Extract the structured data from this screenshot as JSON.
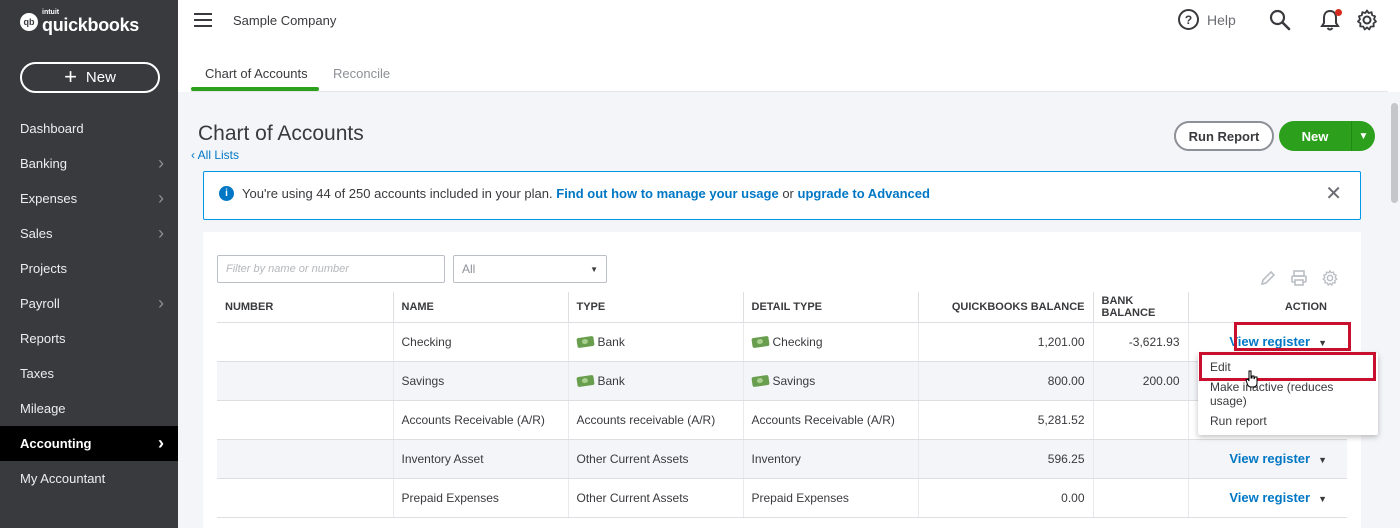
{
  "sidebar": {
    "logo_badge": "qb",
    "logo_intuit": "intuit",
    "logo_name": "quickbooks",
    "new_label": "New",
    "items": [
      {
        "label": "Dashboard",
        "chevron": false
      },
      {
        "label": "Banking",
        "chevron": true
      },
      {
        "label": "Expenses",
        "chevron": true
      },
      {
        "label": "Sales",
        "chevron": true
      },
      {
        "label": "Projects",
        "chevron": false
      },
      {
        "label": "Payroll",
        "chevron": true
      },
      {
        "label": "Reports",
        "chevron": false
      },
      {
        "label": "Taxes",
        "chevron": false
      },
      {
        "label": "Mileage",
        "chevron": false
      },
      {
        "label": "Accounting",
        "chevron": true,
        "active": true
      },
      {
        "label": "My Accountant",
        "chevron": false
      }
    ]
  },
  "header": {
    "company": "Sample Company",
    "help_label": "Help",
    "icons": [
      "search-icon",
      "bell-icon",
      "gear-icon"
    ]
  },
  "tabs": [
    {
      "label": "Chart of Accounts",
      "active": true
    },
    {
      "label": "Reconcile",
      "active": false
    }
  ],
  "page": {
    "title": "Chart of Accounts",
    "back_link": "All Lists",
    "run_report": "Run Report",
    "new_button": "New"
  },
  "banner": {
    "text": "You're using 44 of 250 accounts included in your plan.",
    "link1": "Find out how to manage your usage",
    "middle": " or ",
    "link2": "upgrade to Advanced"
  },
  "filters": {
    "search_placeholder": "Filter by name or number",
    "select_value": "All"
  },
  "table": {
    "headers": [
      "NUMBER",
      "NAME",
      "TYPE",
      "DETAIL TYPE",
      "QUICKBOOKS BALANCE",
      "BANK BALANCE",
      "ACTION"
    ],
    "rows": [
      {
        "number": "",
        "name": "Checking",
        "type": "Bank",
        "type_icon": true,
        "detail": "Checking",
        "detail_icon": true,
        "qb_balance": "1,201.00",
        "bank_balance": "-3,621.93",
        "action": "View register"
      },
      {
        "number": "",
        "name": "Savings",
        "type": "Bank",
        "type_icon": true,
        "detail": "Savings",
        "detail_icon": true,
        "qb_balance": "800.00",
        "bank_balance": "200.00",
        "action": ""
      },
      {
        "number": "",
        "name": "Accounts Receivable (A/R)",
        "type": "Accounts receivable (A/R)",
        "type_icon": false,
        "detail": "Accounts Receivable (A/R)",
        "detail_icon": false,
        "qb_balance": "5,281.52",
        "bank_balance": "",
        "action": ""
      },
      {
        "number": "",
        "name": "Inventory Asset",
        "type": "Other Current Assets",
        "type_icon": false,
        "detail": "Inventory",
        "detail_icon": false,
        "qb_balance": "596.25",
        "bank_balance": "",
        "action": "View register"
      },
      {
        "number": "",
        "name": "Prepaid Expenses",
        "type": "Other Current Assets",
        "type_icon": false,
        "detail": "Prepaid Expenses",
        "detail_icon": false,
        "qb_balance": "0.00",
        "bank_balance": "",
        "action": "View register"
      }
    ]
  },
  "dropdown_menu": {
    "items": [
      "Edit",
      "Make inactive (reduces usage)",
      "Run report"
    ]
  },
  "colors": {
    "sidebar_bg": "#393a3d",
    "brand_green": "#2ca01c",
    "link_blue": "#0077c5",
    "highlight_red": "#c8102e"
  }
}
